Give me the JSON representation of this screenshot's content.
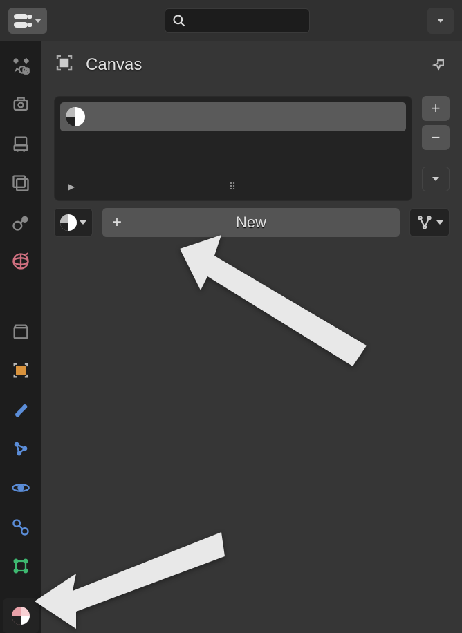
{
  "header": {
    "search_placeholder": ""
  },
  "panel": {
    "title": "Canvas",
    "new_button_label": "New"
  },
  "tabs": [
    {
      "id": "tool",
      "name": "tool-tab"
    },
    {
      "id": "render",
      "name": "render-tab"
    },
    {
      "id": "output",
      "name": "output-tab"
    },
    {
      "id": "viewlayer",
      "name": "viewlayer-tab"
    },
    {
      "id": "scene",
      "name": "scene-tab"
    },
    {
      "id": "world",
      "name": "world-tab"
    },
    {
      "id": "collection",
      "name": "collection-tab"
    },
    {
      "id": "object",
      "name": "object-tab"
    },
    {
      "id": "modifier",
      "name": "modifier-tab"
    },
    {
      "id": "particles",
      "name": "particles-tab"
    },
    {
      "id": "physics",
      "name": "physics-tab"
    },
    {
      "id": "constraints",
      "name": "constraints-tab"
    },
    {
      "id": "data",
      "name": "data-tab"
    },
    {
      "id": "material",
      "name": "material-tab"
    }
  ]
}
